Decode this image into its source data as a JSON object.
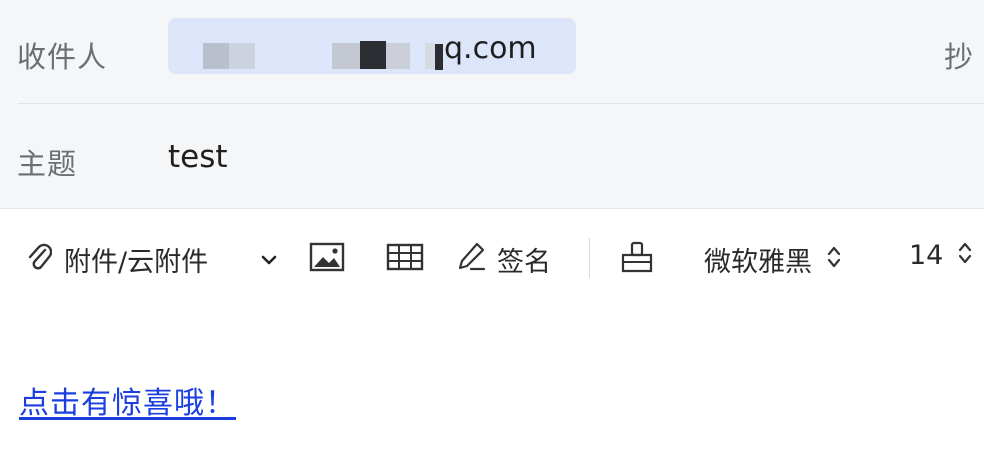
{
  "header": {
    "recipient_label": "收件人",
    "recipient_value": "q.com",
    "cc_label": "抄",
    "subject_label": "主题",
    "subject_value": "test"
  },
  "toolbar": {
    "attachment_label": "附件/云附件",
    "signature_label": "签名",
    "font_name": "微软雅黑",
    "font_size": "14",
    "icons": [
      "paperclip-icon",
      "chevron-down-icon",
      "image-icon",
      "table-icon",
      "pen-icon",
      "format-painter-icon",
      "stepper-icon"
    ]
  },
  "body": {
    "link_text": "点击有惊喜哦！"
  },
  "colors": {
    "header_bg": "#f5f6f7",
    "recipient_chip": "#dde5fb",
    "link": "#1a3ee0"
  }
}
